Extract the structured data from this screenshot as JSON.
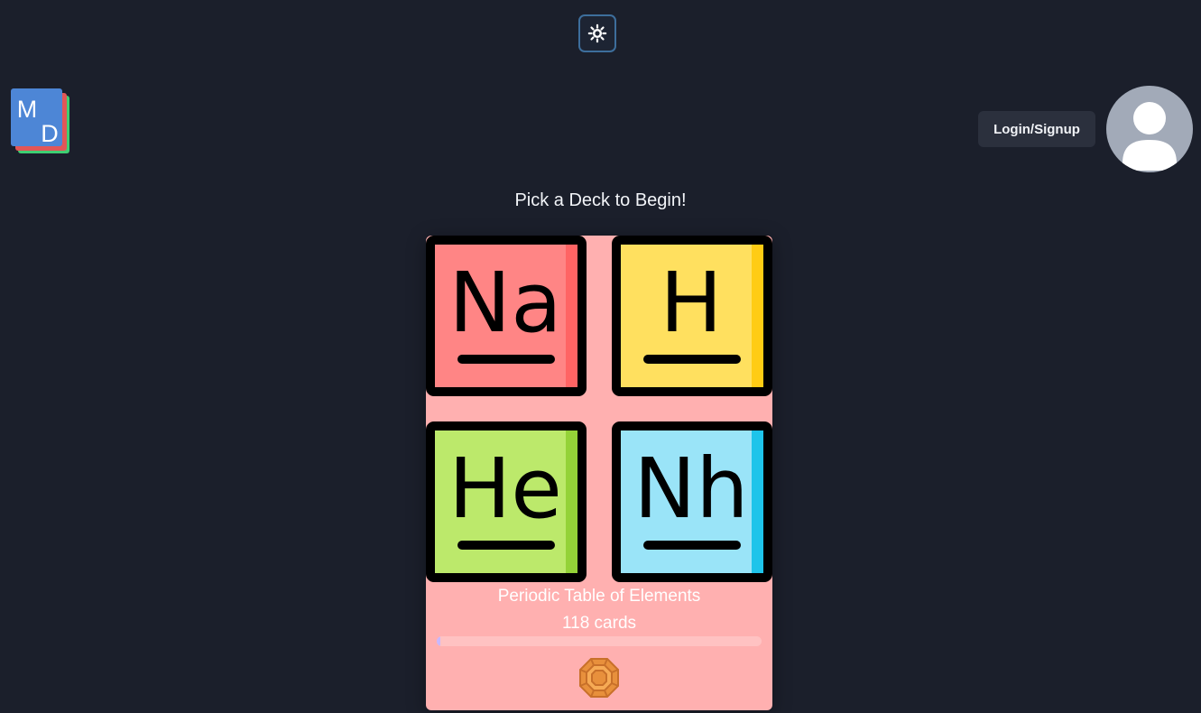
{
  "header": {
    "theme_toggle_icon": "sun-icon",
    "logo_letters": [
      "M",
      "D"
    ],
    "login_label": "Login/Signup",
    "avatar_icon": "user-icon"
  },
  "main": {
    "heading": "Pick a Deck to Begin!",
    "deck": {
      "title": "Periodic Table of Elements",
      "card_count": "118 cards",
      "progress": 0.01,
      "tiles": [
        {
          "symbol": "Na",
          "color": "#ff8585",
          "edge": "#ff6464"
        },
        {
          "symbol": "H",
          "color": "#ffe05f",
          "edge": "#ffcc14"
        },
        {
          "symbol": "He",
          "color": "#bce96b",
          "edge": "#94d238"
        },
        {
          "symbol": "Nh",
          "color": "#9ae4f8",
          "edge": "#1ec4ea"
        }
      ],
      "card_color": "#ffb0b0",
      "badge_icon": "gem-icon"
    }
  },
  "colors": {
    "background": "#1b1f2b",
    "toggle_border": "#3d6e9c",
    "button_bg": "#2b303d",
    "avatar_bg": "#a2aab8"
  }
}
